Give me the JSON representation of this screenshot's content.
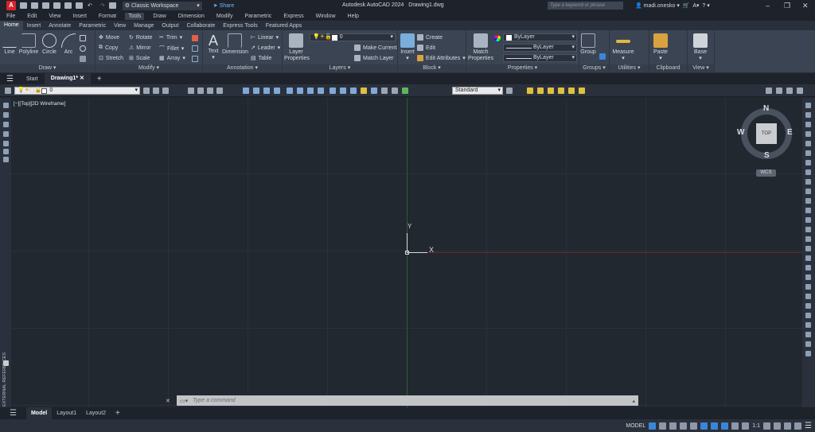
{
  "app": {
    "title": "Autodesk AutoCAD 2024",
    "file": "Drawing1.dwg",
    "logo": "A"
  },
  "quick_access": {
    "workspace": "Classic Workspace",
    "share": "Share"
  },
  "search": {
    "placeholder": "Type a keyword or phrase"
  },
  "user": {
    "name": "madi.onesko"
  },
  "menu": [
    "File",
    "Edit",
    "View",
    "Insert",
    "Format",
    "Tools",
    "Draw",
    "Dimension",
    "Modify",
    "Parametric",
    "Express",
    "Window",
    "Help"
  ],
  "menu_active": "Tools",
  "ribbon_tabs": [
    "Home",
    "Insert",
    "Annotate",
    "Parametric",
    "View",
    "Manage",
    "Output",
    "Collaborate",
    "Express Tools",
    "Featured Apps"
  ],
  "ribbon_active": "Home",
  "panels": {
    "draw": {
      "label": "Draw",
      "big": [
        "Line",
        "Polyline",
        "Circle",
        "Arc"
      ]
    },
    "modify": {
      "label": "Modify",
      "items": [
        "Move",
        "Rotate",
        "Trim",
        "Copy",
        "Mirror",
        "Fillet",
        "Stretch",
        "Scale",
        "Array"
      ]
    },
    "annotation": {
      "label": "Annotation",
      "big": [
        "Text",
        "Dimension"
      ],
      "items": [
        "Linear",
        "Leader",
        "Table"
      ]
    },
    "layers": {
      "label": "Layers",
      "big": "Layer Properties",
      "layer": "0",
      "items": [
        "Make Current",
        "Match Layer"
      ]
    },
    "block": {
      "label": "Block",
      "big": "Insert",
      "items": [
        "Create",
        "Edit",
        "Edit Attributes"
      ]
    },
    "properties": {
      "label": "Properties",
      "big": "Match Properties",
      "color": "ByLayer",
      "linetype": "ByLayer",
      "lineweight": "ByLayer"
    },
    "groups": {
      "label": "Groups",
      "big": "Group"
    },
    "utilities": {
      "label": "Utilities",
      "big": "Measure"
    },
    "clipboard": {
      "label": "Clipboard",
      "big": "Paste"
    },
    "view": {
      "label": "View",
      "big": "Base"
    }
  },
  "file_tabs": {
    "start": "Start",
    "active": "Drawing1*"
  },
  "toolbar": {
    "layer": "0",
    "textstyle": "Standard"
  },
  "viewport": {
    "label": "[−][Top][2D Wireframe]",
    "ucs_x": "X",
    "ucs_y": "Y"
  },
  "viewcube": {
    "n": "N",
    "s": "S",
    "e": "E",
    "w": "W",
    "face": "TOP",
    "wcs": "WCS"
  },
  "palette": {
    "external_refs": "EXTERNAL REFERENCES"
  },
  "command": {
    "placeholder": "Type a command"
  },
  "layout_tabs": [
    "Model",
    "Layout1",
    "Layout2"
  ],
  "status": {
    "model": "MODEL",
    "scale": "1:1"
  },
  "colors": {
    "accent": "#3a86d6",
    "canvas": "#212830",
    "ribbon": "#3b4453",
    "x_axis": "#a03030",
    "y_axis": "#2f6a3a"
  }
}
